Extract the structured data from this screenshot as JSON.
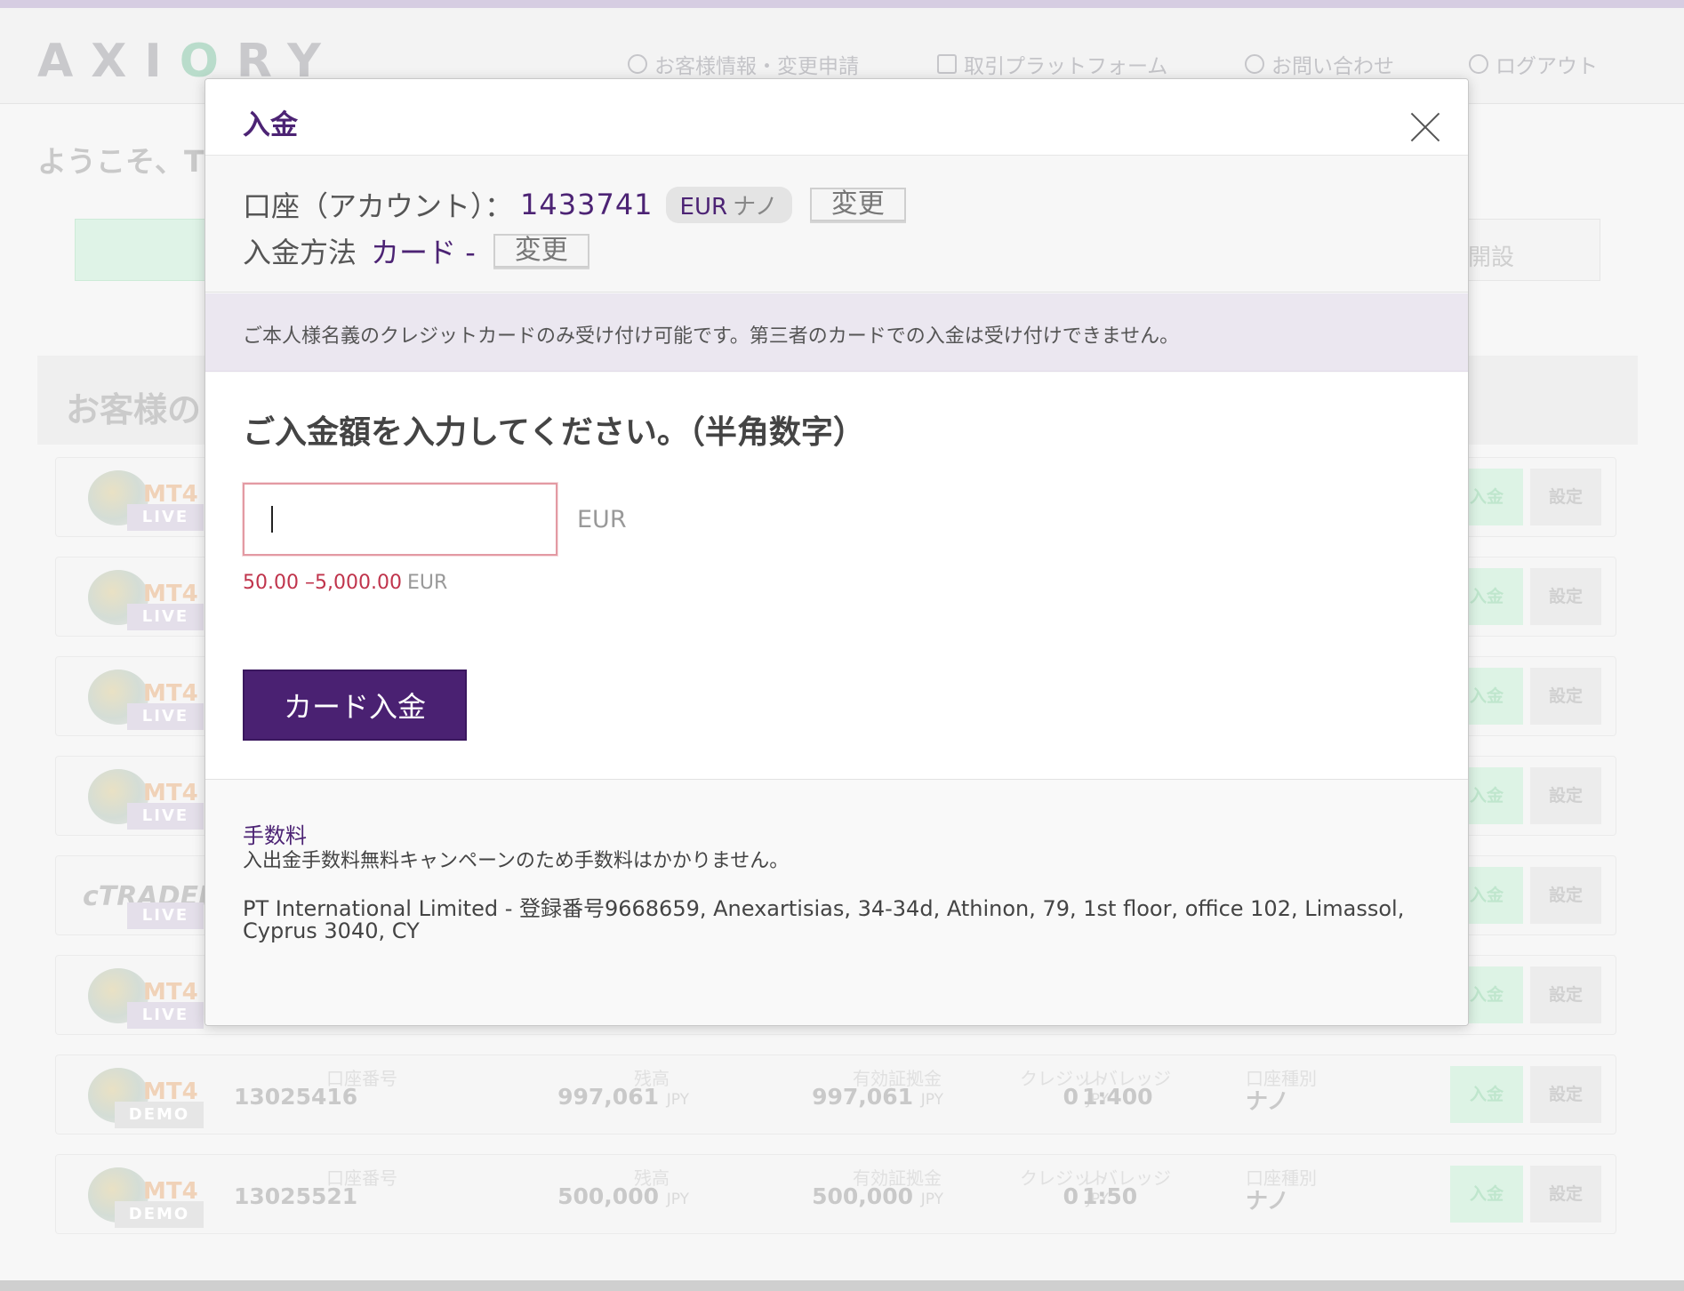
{
  "header": {
    "logo_text": "AXIORY",
    "nav": [
      {
        "label": "お客様情報・変更申請",
        "icon": "user-circle-icon"
      },
      {
        "label": "取引プラットフォーム",
        "icon": "monitor-icon"
      },
      {
        "label": "お問い合わせ",
        "icon": "question-icon"
      },
      {
        "label": "ログアウト",
        "icon": "logout-icon"
      }
    ]
  },
  "background": {
    "welcome": "ようこそ、T",
    "open_account_fragment": "開設",
    "section_title_fragment": "お客様の",
    "accounts": [
      {
        "platform": "MT",
        "version": "4",
        "type": "LIVE",
        "deposit": "入金",
        "settings": "設定"
      },
      {
        "platform": "MT",
        "version": "4",
        "type": "LIVE",
        "deposit": "入金",
        "settings": "設定"
      },
      {
        "platform": "MT",
        "version": "4",
        "type": "LIVE",
        "deposit": "入金",
        "settings": "設定"
      },
      {
        "platform": "MT",
        "version": "4",
        "type": "LIVE",
        "deposit": "入金",
        "settings": "設定"
      },
      {
        "platform": "cTRADER",
        "version": "",
        "type": "LIVE",
        "deposit": "入金",
        "settings": "設定"
      },
      {
        "platform": "MT",
        "version": "4",
        "type": "LIVE",
        "deposit": "入金",
        "settings": "設定"
      },
      {
        "platform": "MT",
        "version": "4",
        "type": "DEMO",
        "deposit": "入金",
        "settings": "設定",
        "account_no_label": "口座番号",
        "account_no": "13025416",
        "balance_label": "残高",
        "balance": "997,061",
        "balance_cur": "JPY",
        "equity_label": "有効証拠金",
        "equity": "997,061",
        "equity_cur": "JPY",
        "credit_label": "クレジット",
        "credit": "0",
        "credit_cur": "JPY",
        "leverage_label": "レバレッジ",
        "leverage": "1:400",
        "kind_label": "口座種別",
        "kind": "ナノ"
      },
      {
        "platform": "MT",
        "version": "4",
        "type": "DEMO",
        "deposit": "入金",
        "settings": "設定",
        "account_no_label": "口座番号",
        "account_no": "13025521",
        "balance_label": "残高",
        "balance": "500,000",
        "balance_cur": "JPY",
        "equity_label": "有効証拠金",
        "equity": "500,000",
        "equity_cur": "JPY",
        "credit_label": "クレジット",
        "credit": "0",
        "credit_cur": "JPY",
        "leverage_label": "レバレッジ",
        "leverage": "1:50",
        "kind_label": "口座種別",
        "kind": "ナノ"
      }
    ]
  },
  "modal": {
    "title": "入金",
    "account_label": "口座（アカウント）：",
    "account_no": "1433741",
    "account_currency": "EUR",
    "account_kind": "ナノ",
    "change_label": "変更",
    "method_label": "入金方法",
    "method_value": "カード -",
    "notice": "ご本人様名義のクレジットカードのみ受け付け可能です。第三者のカードでの入金は受け付けできません。",
    "prompt": "ご入金額を入力してください。（半角数字）",
    "amount_value": "",
    "amount_currency": "EUR",
    "range_text": "50.00 –5,000.00",
    "range_currency": "EUR",
    "submit_label": "カード入金",
    "fee_title": "手数料",
    "fee_text": "入出金手数料無料キャンペーンのため手数料はかかりません。",
    "company_text": "PT International Limited - 登録番号9668659, Anexartisias, 34-34d, Athinon, 79, 1st floor, office 102, Limassol, Cyprus 3040, CY"
  },
  "colors": {
    "brand_purple": "#4a2172",
    "error_red": "#c0344c",
    "notice_bg": "#ebe7f0"
  }
}
